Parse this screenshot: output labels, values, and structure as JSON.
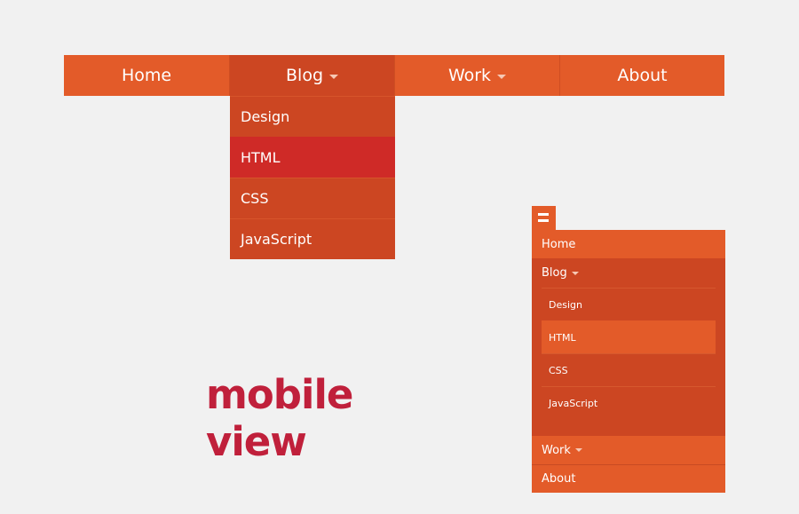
{
  "desktop_nav": {
    "items": [
      {
        "label": "Home"
      },
      {
        "label": "Blog"
      },
      {
        "label": "Work"
      },
      {
        "label": "About"
      }
    ],
    "dropdown": [
      {
        "label": "Design"
      },
      {
        "label": "HTML"
      },
      {
        "label": "CSS"
      },
      {
        "label": "JavaScript"
      }
    ]
  },
  "caption": "mobile view",
  "mobile_nav": {
    "menu_icon": "hamburger-icon",
    "items": [
      {
        "label": "Home"
      },
      {
        "label": "Blog"
      },
      {
        "label": "Work"
      },
      {
        "label": "About"
      }
    ],
    "blog_sub": [
      {
        "label": "Design"
      },
      {
        "label": "HTML"
      },
      {
        "label": "CSS"
      },
      {
        "label": "JavaScript"
      }
    ]
  },
  "colors": {
    "background": "#f1f1f1",
    "nav_orange": "#e35b29",
    "nav_active": "#cc4622",
    "highlight_red": "#cf2a27",
    "caption_red": "#c0203b"
  }
}
